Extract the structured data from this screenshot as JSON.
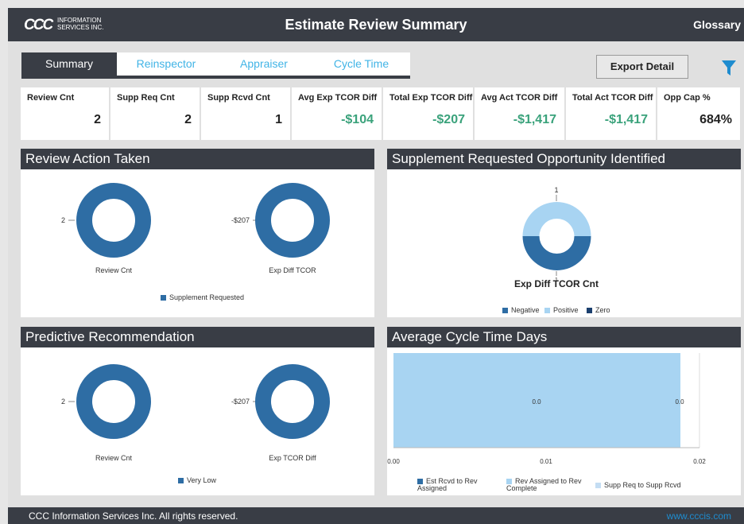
{
  "header": {
    "logo_mark": "CCC",
    "logo_line1": "INFORMATION",
    "logo_line2": "SERVICES INC.",
    "title": "Estimate Review Summary",
    "glossary": "Glossary"
  },
  "tabs": [
    {
      "label": "Summary",
      "active": true
    },
    {
      "label": "Reinspector",
      "active": false
    },
    {
      "label": "Appraiser",
      "active": false
    },
    {
      "label": "Cycle Time",
      "active": false
    }
  ],
  "toolbar": {
    "export_label": "Export Detail",
    "filter_icon": "filter-icon"
  },
  "kpis": [
    {
      "label": "Review Cnt",
      "value": "2"
    },
    {
      "label": "Supp Req Cnt",
      "value": "2"
    },
    {
      "label": "Supp Rcvd Cnt",
      "value": "1"
    },
    {
      "label": "Avg Exp TCOR Diff",
      "value": "-$104"
    },
    {
      "label": "Total Exp TCOR Diff",
      "value": "-$207"
    },
    {
      "label": "Avg Act TCOR Diff",
      "value": "-$1,417"
    },
    {
      "label": "Total Act TCOR Diff",
      "value": "-$1,417"
    },
    {
      "label": "Opp Cap %",
      "value": "684%"
    }
  ],
  "colors": {
    "dark": "#393d45",
    "blue": "#2e6da4",
    "light_blue": "#a8d4f2",
    "navy": "#1b3f6e",
    "green": "#3aa27b",
    "link": "#1e8ccf"
  },
  "panels": {
    "review_action": {
      "title": "Review Action Taken",
      "donut1": {
        "label": "Review Cnt",
        "value_label": "2"
      },
      "donut2": {
        "label": "Exp Diff TCOR",
        "value_label": "-$207"
      },
      "legend": "Supplement Requested"
    },
    "supplement": {
      "title": "Supplement Requested Opportunity Identified",
      "chart_title": "Exp Diff TCOR Cnt",
      "top_label": "1",
      "bottom_label": "1",
      "legend": [
        "Negative",
        "Positive",
        "Zero"
      ]
    },
    "predictive": {
      "title": "Predictive Recommendation",
      "donut1": {
        "label": "Review Cnt",
        "value_label": "2"
      },
      "donut2": {
        "label": "Exp TCOR Diff",
        "value_label": "-$207"
      },
      "legend": "Very Low"
    },
    "cycle": {
      "title": "Average Cycle Time Days",
      "bar_label_mid": "0.0",
      "bar_label_end": "0.0",
      "ticks": [
        "0.00",
        "0.01",
        "0.02"
      ],
      "legend": [
        "Est Rcvd to Rev Assigned",
        "Rev Assigned to Rev Complete",
        "Supp Req to Supp Rcvd"
      ]
    }
  },
  "chart_data": [
    {
      "type": "pie",
      "title": "",
      "labels": [
        "Supplement Requested"
      ],
      "values": [
        2
      ],
      "caption": "Review Cnt"
    },
    {
      "type": "pie",
      "title": "",
      "labels": [
        "Supplement Requested"
      ],
      "values": [
        -207
      ],
      "caption": "Exp Diff TCOR"
    },
    {
      "type": "pie",
      "title": "Exp Diff TCOR Cnt",
      "labels": [
        "Negative",
        "Positive",
        "Zero"
      ],
      "values": [
        1,
        1,
        0
      ]
    },
    {
      "type": "pie",
      "title": "",
      "labels": [
        "Very Low"
      ],
      "values": [
        2
      ],
      "caption": "Review Cnt"
    },
    {
      "type": "pie",
      "title": "",
      "labels": [
        "Very Low"
      ],
      "values": [
        -207
      ],
      "caption": "Exp TCOR Diff"
    },
    {
      "type": "bar",
      "title": "",
      "categories": [
        "Est Rcvd to Rev Assigned",
        "Rev Assigned to Rev Complete",
        "Supp Req to Supp Rcvd"
      ],
      "values": [
        0.0,
        0.0,
        0.0
      ],
      "xlim": [
        0,
        0.02
      ]
    }
  ],
  "footer": {
    "copyright": "CCC Information Services Inc. All rights reserved.",
    "link": "www.cccis.com"
  }
}
